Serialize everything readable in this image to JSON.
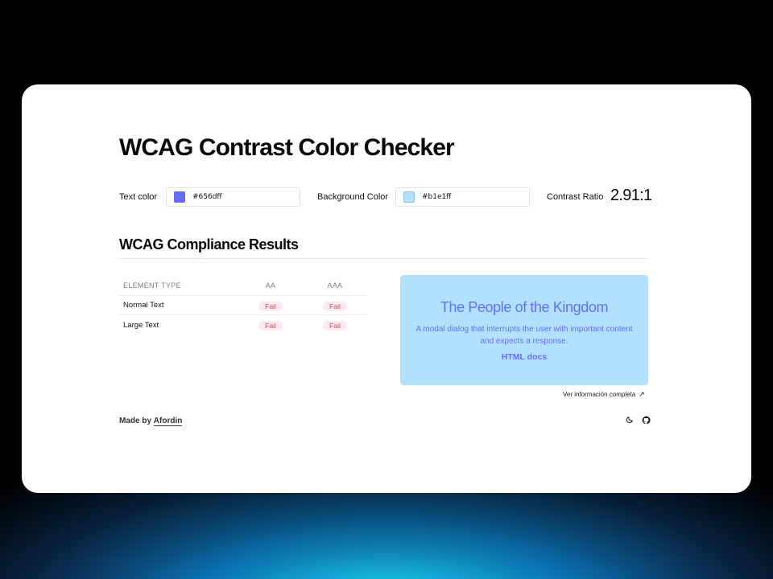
{
  "page": {
    "title": "WCAG Contrast Color Checker"
  },
  "colors": {
    "accent": "#656dff",
    "preview_background": "#b1e1ff",
    "fail_text": "#d04a5a",
    "fail_background": "#fde8ec"
  },
  "controls": {
    "text_color": {
      "label": "Text color",
      "value": "#656dff"
    },
    "background_color": {
      "label": "Background Color",
      "value": "#b1e1ff"
    },
    "contrast_ratio": {
      "label": "Contrast Ratio",
      "value": "2.91:1"
    }
  },
  "results": {
    "title": "WCAG Compliance Results",
    "columns": [
      "ELEMENT TYPE",
      "AA",
      "AAA"
    ],
    "rows": [
      {
        "element_type": "Normal Text",
        "aa": "Fail",
        "aaa": "Fail"
      },
      {
        "element_type": "Large Text",
        "aa": "Fail",
        "aaa": "Fail"
      }
    ]
  },
  "preview": {
    "heading": "The People of the Kingdom",
    "body": "A modal dialog that interrupts the user with important content and expects a response.",
    "link": "HTML docs"
  },
  "more_info": {
    "label": "Ver información completa",
    "icon": "arrow-up-right-icon"
  },
  "footer": {
    "made_by_prefix": "Made by",
    "author": "Afordin",
    "icons": [
      "moon-icon",
      "github-icon"
    ]
  }
}
